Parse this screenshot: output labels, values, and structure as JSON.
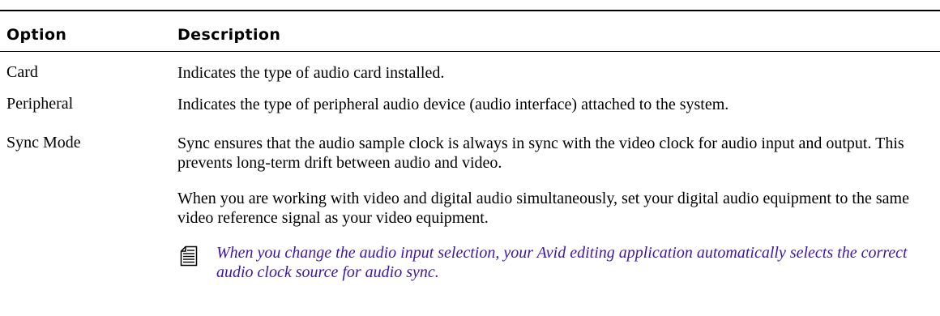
{
  "table": {
    "headers": {
      "option": "Option",
      "description": "Description"
    },
    "rows": [
      {
        "option": "Card",
        "description": "Indicates the type of audio card installed."
      },
      {
        "option": "Peripheral",
        "description": "Indicates the type of peripheral audio device (audio interface) attached to the system."
      },
      {
        "option": "Sync Mode",
        "paragraphs": [
          "Sync ensures that the audio sample clock is always in sync with the video clock for audio input and output. This prevents long-term drift between audio and video.",
          "When you are working with video and digital audio simultaneously, set your digital audio equipment to the same video reference signal as your video equipment."
        ],
        "note": {
          "icon": "note-icon",
          "text": "When you change the audio input selection, your Avid editing application automatically selects the correct audio clock source for audio sync.",
          "color": "#3e16a6"
        }
      }
    ]
  }
}
